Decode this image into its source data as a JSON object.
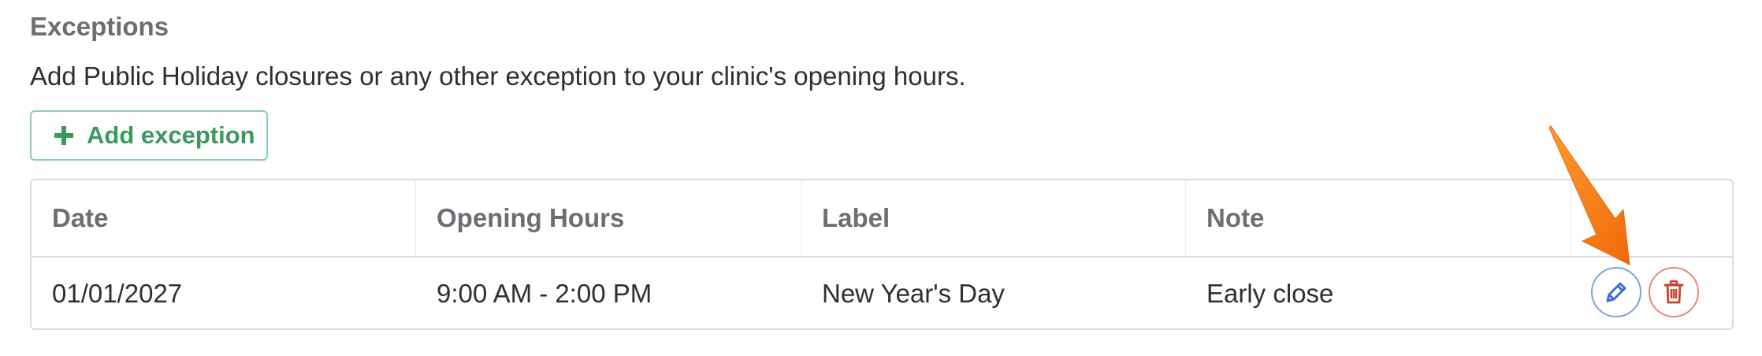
{
  "section": {
    "title": "Exceptions",
    "description": "Add Public Holiday closures or any other exception to your clinic's opening hours."
  },
  "add_button": {
    "label": "Add exception",
    "icon": "plus-icon",
    "color": "#3a9a5c"
  },
  "table": {
    "columns": [
      "Date",
      "Opening Hours",
      "Label",
      "Note",
      ""
    ],
    "rows": [
      {
        "date": "01/01/2027",
        "opening_hours": "9:00 AM - 2:00 PM",
        "label": "New Year's Day",
        "note": "Early close",
        "actions": [
          {
            "icon": "pencil-icon",
            "color": "#3a6fd0"
          },
          {
            "icon": "trash-icon",
            "color": "#c8432f"
          }
        ]
      }
    ]
  },
  "annotation": {
    "icon": "arrow-icon",
    "color": "#f37a12"
  }
}
